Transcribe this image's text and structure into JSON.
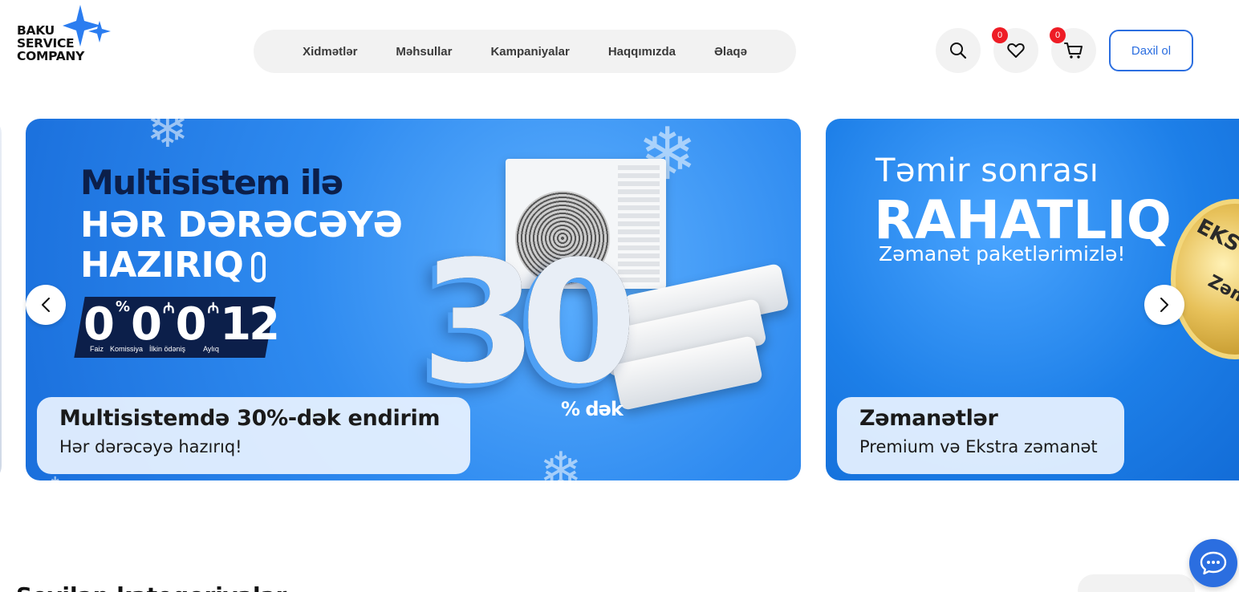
{
  "brand": {
    "logo_lines": [
      "BAKU",
      "SERVICE",
      "COMPANY"
    ],
    "accent_color": "#2b6ee0",
    "badge_color": "#ee1c25"
  },
  "nav": {
    "items": [
      {
        "label": "Xidmətlər"
      },
      {
        "label": "Məhsullar"
      },
      {
        "label": "Kampaniyalar"
      },
      {
        "label": "Haqqımızda"
      },
      {
        "label": "Əlaqə"
      }
    ]
  },
  "header_actions": {
    "search_icon": "search-icon",
    "favorites_count": "0",
    "cart_count": "0",
    "login_label": "Daxil ol"
  },
  "slides": [
    {
      "banner_title": "Multisistem ilə",
      "banner_lines": [
        "HƏR DƏRƏCƏYƏ",
        "HAZIRIQ"
      ],
      "offer_values": [
        "0",
        "0",
        "0",
        "12"
      ],
      "offer_symbols": [
        "%",
        "₼",
        "₼"
      ],
      "offer_labels": [
        "Faiz",
        "Komissiya",
        "İlkin ödəniş",
        "Aylıq"
      ],
      "discount_value": "30",
      "discount_suffix": "% dək",
      "caption_title": "Multisistemdə 30%-dək endirim",
      "caption_subtitle": "Hər dərəcəyə hazırıq!"
    },
    {
      "banner_line_1": "Təmir sonrası",
      "banner_line_2": "RAHATLIQ",
      "banner_line_3": "Zəmanət paketlərimizlə!",
      "seal_text": "EKST",
      "seal_text_2": "Zəmə",
      "caption_title": "Zəmanətlər",
      "caption_subtitle": "Premium və Ekstra zəmanət"
    }
  ],
  "section": {
    "title": "Sevilən kateqoriyalar"
  }
}
